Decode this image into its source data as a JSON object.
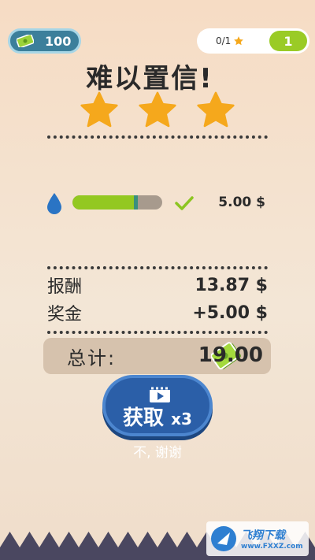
{
  "top_bar": {
    "cash": "100",
    "stars_progress": "0/1",
    "level": "1"
  },
  "title": "难以置信!",
  "stars_earned": 3,
  "stars_total": 3,
  "bonus": {
    "progress": 0.7,
    "value": "5.00 $"
  },
  "rows": {
    "reward_label": "报酬",
    "reward_value": "13.87 $",
    "bonus_label": "奖金",
    "bonus_value": "+5.00 $"
  },
  "total": {
    "label": "总计:",
    "value": "19.00"
  },
  "get_button": {
    "label": "获取",
    "multiplier": "x3"
  },
  "no_thanks": "不, 谢谢",
  "watermark": {
    "brand": "飞翔下载",
    "url": "www.FXXZ.com"
  },
  "colors": {
    "accent_green": "#93c821",
    "star_orange": "#f5a81c",
    "button_blue": "#2b5fa8"
  }
}
